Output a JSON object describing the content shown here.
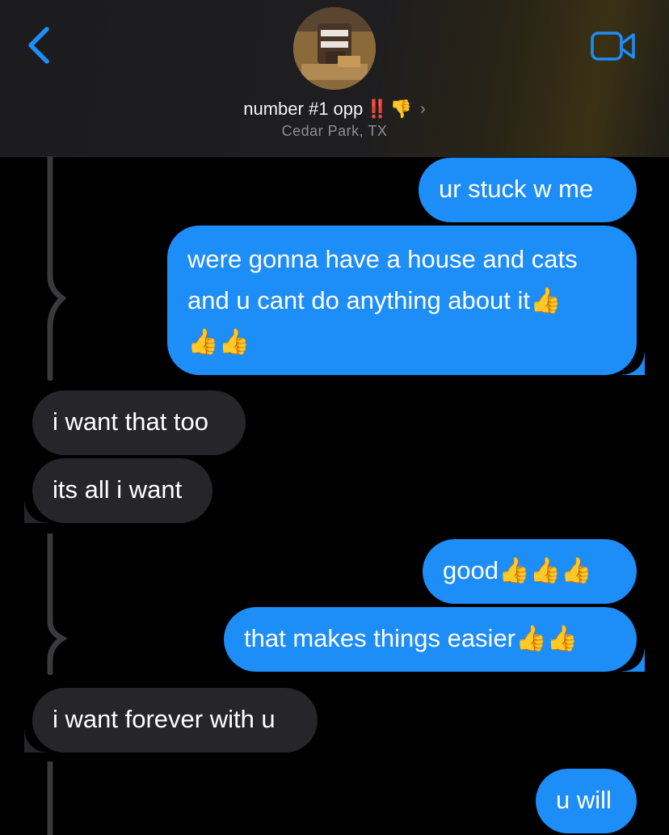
{
  "header": {
    "contact_name": "number #1 opp",
    "name_badge": "‼️",
    "name_emoji": "👎",
    "location": "Cedar Park, TX",
    "back_icon": "chevron-left-icon",
    "video_icon": "video-camera-icon",
    "accent_color": "#1d8df7"
  },
  "messages": [
    {
      "id": "m1",
      "direction": "outgoing",
      "text": "ur stuck w me"
    },
    {
      "id": "m2",
      "direction": "outgoing",
      "line1": "were gonna have a house and cats",
      "line2": "and u cant do anything about it👍",
      "line3": "👍👍"
    },
    {
      "id": "m3",
      "direction": "incoming",
      "text": "i want that too"
    },
    {
      "id": "m4",
      "direction": "incoming",
      "text": "its all i want"
    },
    {
      "id": "m5",
      "direction": "outgoing",
      "text": "good👍👍👍"
    },
    {
      "id": "m6",
      "direction": "outgoing",
      "text": "that makes things easier👍👍"
    },
    {
      "id": "m7",
      "direction": "incoming",
      "text": "i want forever with u"
    },
    {
      "id": "m8",
      "direction": "outgoing",
      "text": "u will"
    }
  ],
  "colors": {
    "outgoing_bubble": "#1d8df7",
    "incoming_bubble": "#26252a",
    "background": "#000000",
    "thread_line": "#3a3a3c"
  }
}
